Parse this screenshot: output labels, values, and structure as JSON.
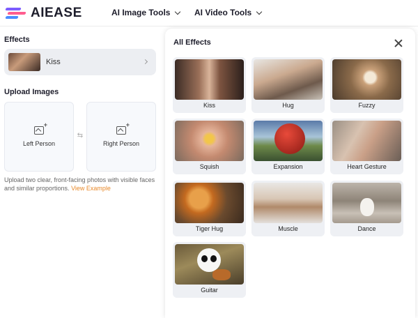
{
  "header": {
    "brand": "AIEASE",
    "nav": [
      {
        "label": "AI Image Tools"
      },
      {
        "label": "AI Video Tools"
      }
    ]
  },
  "left_panel": {
    "effects_title": "Effects",
    "selected_effect": "Kiss",
    "upload_title": "Upload Images",
    "upload_boxes": [
      {
        "label": "Left Person"
      },
      {
        "label": "Right Person"
      }
    ],
    "hint": "Upload two clear, front-facing photos with visible faces and similar proportions.",
    "hint_link": "View Example"
  },
  "effects_popup": {
    "title": "All Effects",
    "items": [
      {
        "label": "Kiss"
      },
      {
        "label": "Hug"
      },
      {
        "label": "Fuzzy"
      },
      {
        "label": "Squish"
      },
      {
        "label": "Expansion"
      },
      {
        "label": "Heart Gesture"
      },
      {
        "label": "Tiger Hug"
      },
      {
        "label": "Muscle"
      },
      {
        "label": "Dance"
      },
      {
        "label": "Guitar"
      }
    ]
  },
  "colors": {
    "accent_link": "#e8892a",
    "card_bg": "#eef0f4",
    "selected_bg": "#eceef2"
  },
  "icons": [
    "logo-mark",
    "chevron-down-icon",
    "chevron-right-icon",
    "image-plus-icon",
    "swap-icon",
    "close-icon"
  ]
}
